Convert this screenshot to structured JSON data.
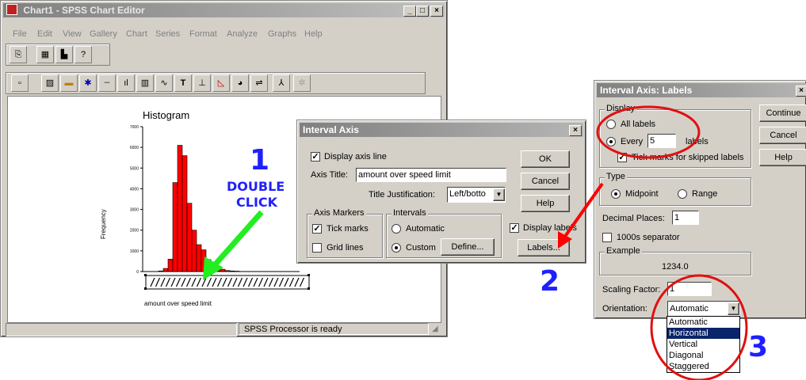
{
  "main_window": {
    "title": "Chart1 - SPSS Chart Editor",
    "menu": [
      "File",
      "Edit",
      "View",
      "Gallery",
      "Chart",
      "Series",
      "Format",
      "Analyze",
      "Graphs",
      "Help"
    ],
    "status": "SPSS Processor  is ready"
  },
  "chart": {
    "title": "Histogram",
    "ylabel": "Frequency",
    "xlabel": "amount over speed limit",
    "yticks": [
      "7000",
      "6000",
      "5000",
      "4000",
      "3000",
      "2000",
      "1000",
      "0"
    ],
    "bar_color": "#ff0000"
  },
  "chart_data": {
    "type": "bar",
    "title": "Histogram",
    "ylabel": "Frequency",
    "xlabel": "amount over speed limit",
    "ylim": [
      0,
      7000
    ],
    "values": [
      30,
      150,
      600,
      4300,
      6100,
      5600,
      3300,
      2000,
      1300,
      1050,
      580,
      400,
      230,
      110,
      50,
      30,
      20
    ]
  },
  "annotations": {
    "step1_num": "1",
    "step1_line1": "DOUBLE",
    "step1_line2": "CLICK",
    "step2_num": "2",
    "step3_num": "3",
    "arrow_green": "#22ee22",
    "arrow_red": "#ff0000",
    "circle_red": "#e01010"
  },
  "interval_axis": {
    "title": "Interval Axis",
    "display_axis_line": "Display axis line",
    "axis_title_label": "Axis Title:",
    "axis_title_value": "amount over speed limit",
    "title_just_label": "Title Justification:",
    "title_just_value": "Left/botto",
    "axis_markers": "Axis Markers",
    "tick_marks": "Tick marks",
    "grid_lines": "Grid lines",
    "intervals": "Intervals",
    "automatic": "Automatic",
    "custom": "Custom",
    "define": "Define...",
    "display_labels": "Display labels",
    "labels_btn": "Labels...",
    "ok": "OK",
    "cancel": "Cancel",
    "help": "Help"
  },
  "labels_dialog": {
    "title": "Interval Axis: Labels",
    "display": "Display",
    "all_labels": "All labels",
    "every": "Every",
    "every_value": "5",
    "labels_word": "labels",
    "tick_marks_skipped": "Tick marks for skipped labels",
    "type": "Type",
    "midpoint": "Midpoint",
    "range": "Range",
    "decimal_places": "Decimal Places:",
    "decimal_value": "1",
    "separator": "1000s separator",
    "example": "Example",
    "example_value": "1234.0",
    "scaling_factor": "Scaling Factor:",
    "scaling_value": "1",
    "orientation": "Orientation:",
    "orientation_value": "Automatic",
    "orientation_options": [
      "Automatic",
      "Horizontal",
      "Vertical",
      "Diagonal",
      "Staggered"
    ],
    "continue": "Continue",
    "cancel": "Cancel",
    "help": "Help"
  }
}
